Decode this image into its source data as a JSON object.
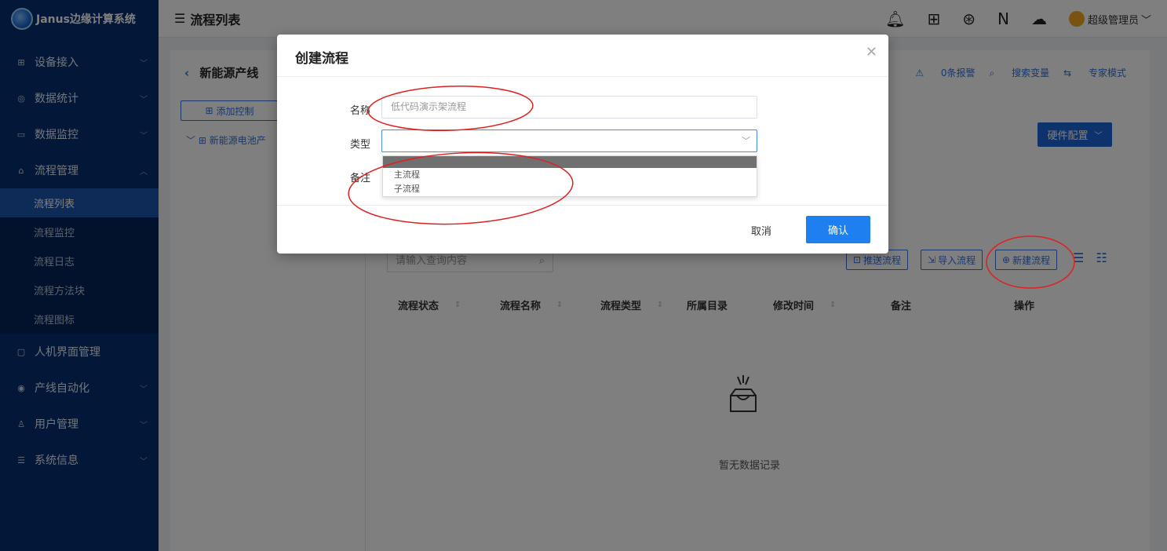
{
  "app": {
    "name": "Janus边缘计算系统"
  },
  "sidebar": {
    "items": [
      {
        "label": "设备接入",
        "icon": "device-icon"
      },
      {
        "label": "数据统计",
        "icon": "stats-icon"
      },
      {
        "label": "数据监控",
        "icon": "monitor-icon"
      },
      {
        "label": "流程管理",
        "icon": "flow-icon"
      }
    ],
    "sub": [
      {
        "label": "流程列表"
      },
      {
        "label": "流程监控"
      },
      {
        "label": "流程日志"
      },
      {
        "label": "流程方法块"
      },
      {
        "label": "流程图标"
      }
    ],
    "items2": [
      {
        "label": "人机界面管理"
      },
      {
        "label": "产线自动化"
      },
      {
        "label": "用户管理"
      },
      {
        "label": "系统信息"
      }
    ]
  },
  "topbar": {
    "title": "流程列表",
    "user": "超级管理员"
  },
  "content": {
    "back_label": "新能源产线",
    "tools": [
      "0条报警",
      "搜索变量",
      "专家模式"
    ],
    "add_control": "添加控制",
    "tree_item": "新能源电池产",
    "hw_config": "硬件配置",
    "search_placeholder": "请输入查询内容",
    "buttons": {
      "push": "推送流程",
      "import": "导入流程",
      "new": "新建流程"
    },
    "columns": [
      "流程状态",
      "流程名称",
      "流程类型",
      "所属目录",
      "修改时间",
      "备注",
      "操作"
    ],
    "empty": "暂无数据记录"
  },
  "modal": {
    "title": "创建流程",
    "name_label": "名称",
    "name_value": "低代码演示架流程",
    "type_label": "类型",
    "note_label": "备注",
    "options": [
      "主流程",
      "子流程"
    ],
    "cancel": "取消",
    "confirm": "确认"
  },
  "colors": {
    "sidebar": "#062e70",
    "accent": "#1d7ff0",
    "annotation": "#e02020"
  }
}
